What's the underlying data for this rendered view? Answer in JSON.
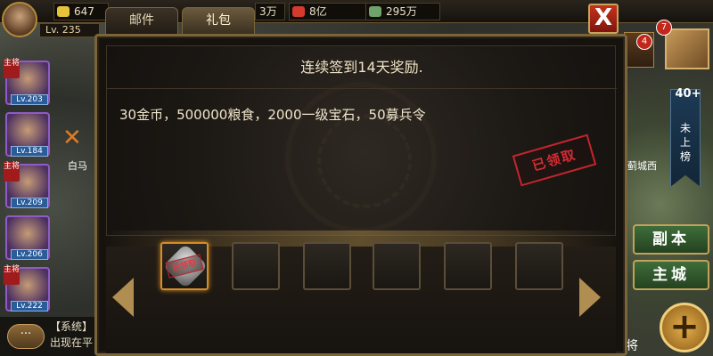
{
  "topbar": {
    "level": "Lv. 235",
    "resources": [
      {
        "value": "647",
        "icon": "gold-ingot-icon",
        "color": "#e7c33a"
      },
      {
        "value": "3万",
        "icon": "coin-icon",
        "color": "#d9a843"
      },
      {
        "value": "8亿",
        "icon": "food-icon",
        "color": "#d43b2e"
      },
      {
        "value": "295万",
        "icon": "stone-icon",
        "color": "#6fa36b"
      }
    ]
  },
  "tabs": {
    "mail": "邮件",
    "gift": "礼包"
  },
  "close_label": "X",
  "panel": {
    "title": "连续签到14天奖励.",
    "rewards_text": "30金币，500000粮食，2000一级宝石，50募兵令",
    "stamp_text": "已领取",
    "slot_stamp": "已领取",
    "slots": [
      "selected",
      "",
      "",
      "",
      "",
      ""
    ]
  },
  "heroes": [
    {
      "level": "Lv.203",
      "role": "主将"
    },
    {
      "level": "Lv.184",
      "role": ""
    },
    {
      "level": "Lv.209",
      "role": "主将"
    },
    {
      "level": "Lv.206",
      "role": ""
    },
    {
      "level": "Lv.222",
      "role": "主将"
    }
  ],
  "left_labels": {
    "city": "白马"
  },
  "chat": {
    "channel": "【系统】",
    "message": "出现在平",
    "bubble": "···"
  },
  "right": {
    "badges": [
      "7",
      "4"
    ],
    "rank_number": "40+",
    "rank_text": "未上榜",
    "city_label": "蓟城西",
    "dungeon_button": "副本",
    "main_city_button": "主城",
    "general_label": "将",
    "plus_label": "+"
  }
}
